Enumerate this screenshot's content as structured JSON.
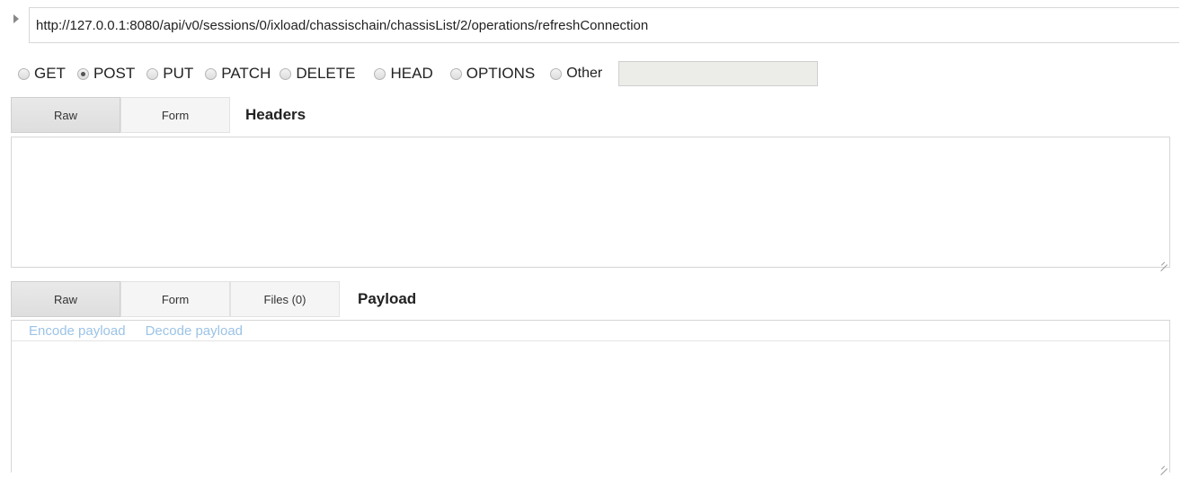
{
  "request": {
    "url": "http://127.0.0.1:8080/api/v0/sessions/0/ixload/chassischain/chassisList/2/operations/refreshConnection",
    "expand_icon": "triangle-right-icon"
  },
  "methods": {
    "selected": "POST",
    "options": [
      "GET",
      "POST",
      "PUT",
      "PATCH",
      "DELETE",
      "HEAD",
      "OPTIONS",
      "Other"
    ],
    "other_value": ""
  },
  "headers": {
    "tabs": [
      "Raw",
      "Form"
    ],
    "active_tab": "Raw",
    "title": "Headers",
    "value": ""
  },
  "payload": {
    "tabs": [
      "Raw",
      "Form",
      "Files (0)"
    ],
    "active_tab": "Raw",
    "title": "Payload",
    "encode_link": "Encode payload",
    "decode_link": "Decode payload",
    "value": ""
  },
  "colors": {
    "link": "#9cc3e6",
    "active_tab": "#e2e2e2",
    "border": "#d6d6d6",
    "other_input_bg": "#ecece8"
  }
}
